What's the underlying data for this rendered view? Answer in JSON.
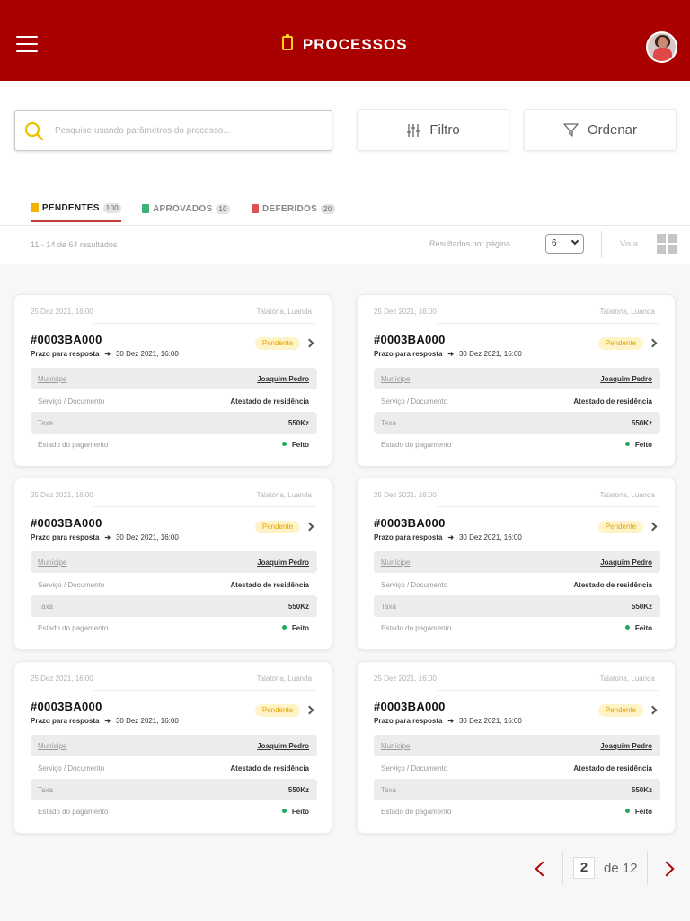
{
  "header": {
    "title": "PROCESSOS"
  },
  "search": {
    "placeholder": "Pesquise usando parâmetros do processo..."
  },
  "toolbar": {
    "filter_label": "Filtro",
    "sort_label": "Ordenar"
  },
  "tabs": [
    {
      "label": "PENDENTES",
      "count": "100",
      "color": "#f0b400"
    },
    {
      "label": "APROVADOS",
      "count": "10",
      "color": "#3cb371"
    },
    {
      "label": "DEFERIDOS",
      "count": "20",
      "color": "#e05050"
    }
  ],
  "results": {
    "count_text": "11 - 14 de 64 resultados",
    "per_page_label": "Resultados por página",
    "per_page_value": "6",
    "view_label": "Vista"
  },
  "cards": [
    {
      "date": "25 Dez 2021, 16:00",
      "location": "Talatona, Luanda",
      "id": "#0003BA000",
      "deadline_label": "Prazo para resposta",
      "deadline": "30 Dez 2021, 16:00",
      "status": "Pendente",
      "municipe_label": "Munícipe",
      "municipe": "Joaquim Pedro",
      "servico_label": "Serviço / Documento",
      "servico": "Atestado de residência",
      "taxa_label": "Taxa",
      "taxa": "550Kz",
      "pagamento_label": "Estado do pagamento",
      "pagamento": "Feito"
    },
    {
      "date": "25 Dez 2021, 16:00",
      "location": "Talatona, Luanda",
      "id": "#0003BA000",
      "deadline_label": "Prazo para resposta",
      "deadline": "30 Dez 2021, 16:00",
      "status": "Pendente",
      "municipe_label": "Munícipe",
      "municipe": "Joaquim Pedro",
      "servico_label": "Serviço / Documento",
      "servico": "Atestado de residência",
      "taxa_label": "Taxa",
      "taxa": "550Kz",
      "pagamento_label": "Estado do pagamento",
      "pagamento": "Feito"
    },
    {
      "date": "25 Dez 2021, 16:00",
      "location": "Talatona, Luanda",
      "id": "#0003BA000",
      "deadline_label": "Prazo para resposta",
      "deadline": "30 Dez 2021, 16:00",
      "status": "Pendente",
      "municipe_label": "Munícipe",
      "municipe": "Joaquim Pedro",
      "servico_label": "Serviço / Documento",
      "servico": "Atestado de residência",
      "taxa_label": "Taxa",
      "taxa": "550Kz",
      "pagamento_label": "Estado do pagamento",
      "pagamento": "Feito"
    },
    {
      "date": "25 Dez 2021, 16:00",
      "location": "Talatona, Luanda",
      "id": "#0003BA000",
      "deadline_label": "Prazo para resposta",
      "deadline": "30 Dez 2021, 16:00",
      "status": "Pendente",
      "municipe_label": "Munícipe",
      "municipe": "Joaquim Pedro",
      "servico_label": "Serviço / Documento",
      "servico": "Atestado de residência",
      "taxa_label": "Taxa",
      "taxa": "550Kz",
      "pagamento_label": "Estado do pagamento",
      "pagamento": "Feito"
    },
    {
      "date": "25 Dez 2021, 16:00",
      "location": "Talatona, Luanda",
      "id": "#0003BA000",
      "deadline_label": "Prazo para resposta",
      "deadline": "30 Dez 2021, 16:00",
      "status": "Pendente",
      "municipe_label": "Munícipe",
      "municipe": "Joaquim Pedro",
      "servico_label": "Serviço / Documento",
      "servico": "Atestado de residência",
      "taxa_label": "Taxa",
      "taxa": "550Kz",
      "pagamento_label": "Estado do pagamento",
      "pagamento": "Feito"
    },
    {
      "date": "25 Dez 2021, 16:00",
      "location": "Talatona, Luanda",
      "id": "#0003BA000",
      "deadline_label": "Prazo para resposta",
      "deadline": "30 Dez 2021, 16:00",
      "status": "Pendente",
      "municipe_label": "Munícipe",
      "municipe": "Joaquim Pedro",
      "servico_label": "Serviço / Documento",
      "servico": "Atestado de residência",
      "taxa_label": "Taxa",
      "taxa": "550Kz",
      "pagamento_label": "Estado do pagamento",
      "pagamento": "Feito"
    }
  ],
  "pagination": {
    "current": "2",
    "of_text": "de 12"
  },
  "colors": {
    "brand": "#a90000",
    "accent": "#ffd21f",
    "pending_badge": "#fff4c8",
    "paid_dot": "#1ea862"
  },
  "icons": [
    "menu-icon",
    "clipboard-icon",
    "search-icon",
    "sliders-icon",
    "funnel-icon",
    "grid-view-icon",
    "chevron-right-icon",
    "chevron-left-icon",
    "arrow-right-icon"
  ]
}
